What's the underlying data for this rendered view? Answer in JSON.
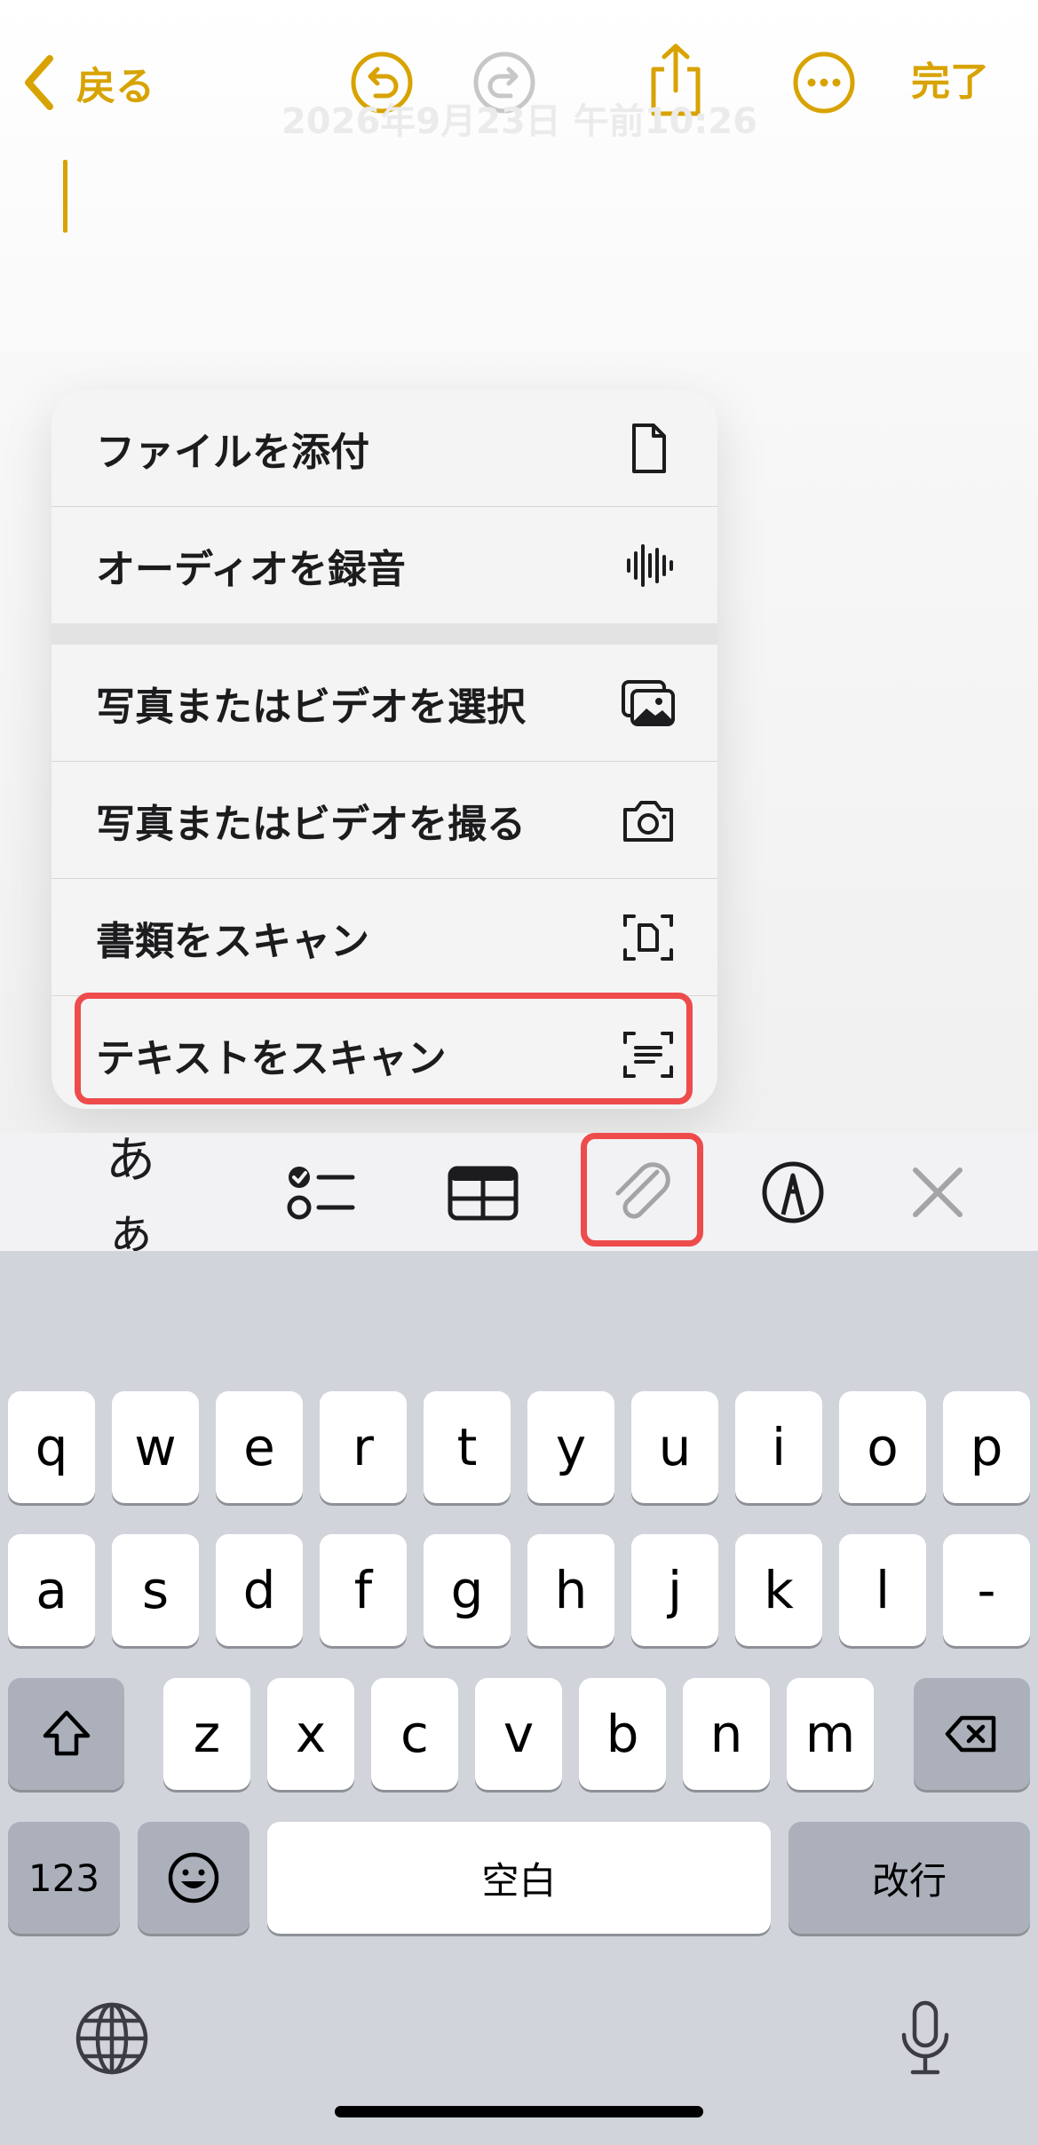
{
  "header": {
    "back_label": "戻る",
    "done_label": "完了",
    "date_text": "2026年9月23日 午前10:26"
  },
  "menu": {
    "items": [
      {
        "label": "ファイルを添付",
        "icon": "document-icon"
      },
      {
        "label": "オーディオを録音",
        "icon": "waveform-icon"
      },
      {
        "label": "写真またはビデオを選択",
        "icon": "photo-library-icon"
      },
      {
        "label": "写真またはビデオを撮る",
        "icon": "camera-icon"
      },
      {
        "label": "書類をスキャン",
        "icon": "doc-scan-icon"
      },
      {
        "label": "テキストをスキャン",
        "icon": "text-scan-icon"
      }
    ]
  },
  "toolbar": {
    "format_label": "あぁ",
    "icons": [
      "checklist-icon",
      "table-icon",
      "paperclip-icon",
      "markup-pen-icon",
      "close-icon"
    ]
  },
  "keyboard": {
    "row1": [
      "q",
      "w",
      "e",
      "r",
      "t",
      "y",
      "u",
      "i",
      "o",
      "p"
    ],
    "row2": [
      "a",
      "s",
      "d",
      "f",
      "g",
      "h",
      "j",
      "k",
      "l",
      "-"
    ],
    "row3": [
      "z",
      "x",
      "c",
      "v",
      "b",
      "n",
      "m"
    ],
    "numbers_label": "123",
    "space_label": "空白",
    "return_label": "改行"
  },
  "colors": {
    "accent": "#d8a300",
    "highlight": "#ee4b4b",
    "keyboard_bg": "#d1d4da"
  }
}
